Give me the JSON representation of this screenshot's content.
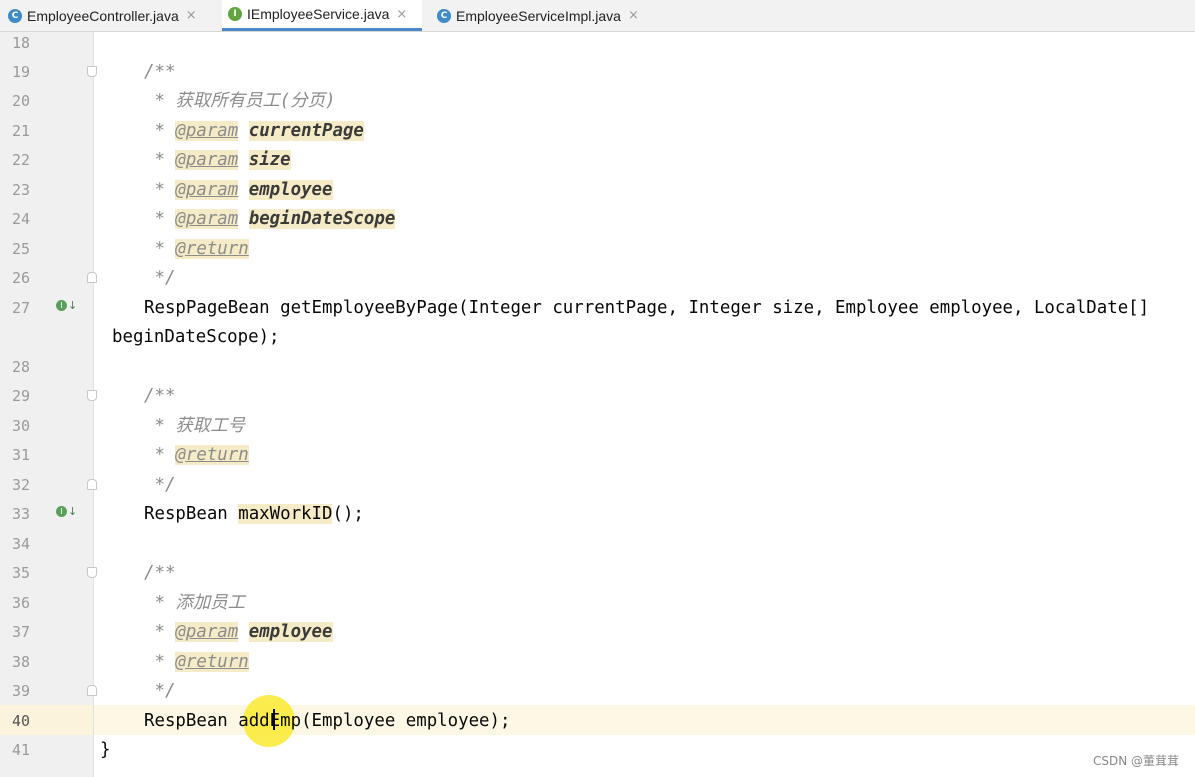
{
  "tabs": [
    {
      "label": "EmployeeController.java",
      "icon": "class-file-icon",
      "icon_glyph": "C",
      "close": "×"
    },
    {
      "label": "IEmployeeService.java",
      "icon": "interface-file-icon",
      "icon_glyph": "I",
      "close": "×"
    },
    {
      "label": "EmployeeServiceImpl.java",
      "icon": "class-file-icon",
      "icon_glyph": "C",
      "close": "×"
    }
  ],
  "line_numbers": [
    "18",
    "19",
    "20",
    "21",
    "22",
    "23",
    "24",
    "25",
    "26",
    "27",
    "",
    "28",
    "29",
    "30",
    "31",
    "32",
    "33",
    "34",
    "35",
    "36",
    "37",
    "38",
    "39",
    "40",
    "41"
  ],
  "code": {
    "c19": "/**",
    "c20_star": " * ",
    "c20_text": "获取所有员工(分页)",
    "star": " * ",
    "param_tag": "@param",
    "return_tag": "@return",
    "p_currentPage": "currentPage",
    "p_size": "size",
    "p_employee": "employee",
    "p_beginDateScope": "beginDateScope",
    "close_comment": " */",
    "l27_a": "RespPageBean getEmployeeByPage(Integer currentPage, Integer size, Employee employee, LocalDate[]",
    "l27_b": "beginDateScope);",
    "c29": "/**",
    "c30_text": "获取工号",
    "l33_type": "RespBean ",
    "l33_method": "maxWorkID",
    "l33_rest": "();",
    "c35": "/**",
    "c36_text": "添加员工",
    "l40_type": "RespBean ",
    "l40_method": "addEmp",
    "l40_rest": "(Employee employee);",
    "l41": "}"
  },
  "watermark": "CSDN @董茸茸"
}
